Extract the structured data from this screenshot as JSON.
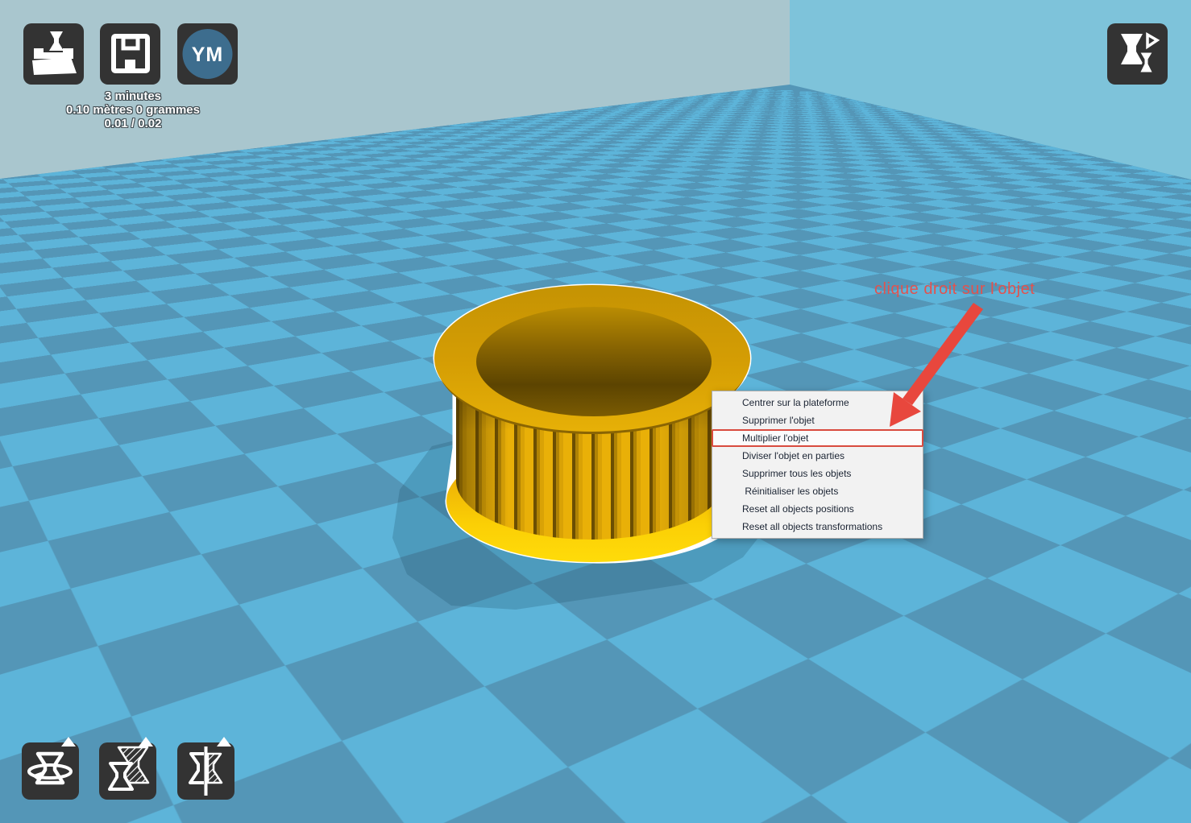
{
  "toolbar": {
    "ym_label": "YM"
  },
  "stats": {
    "line1": "3 minutes",
    "line2": "0.10 mètres 0 grammes",
    "line3": "0.01 / 0.02"
  },
  "annotation": {
    "label": "clique droit sur l'objet"
  },
  "context_menu": {
    "items": [
      "Centrer sur la plateforme",
      "Supprimer l'objet",
      "Multiplier l'objet",
      "Diviser l'objet en parties",
      "Supprimer tous les objets",
      " Réinitialiser les objets",
      "Reset all objects positions",
      "Reset all objects transformations"
    ],
    "highlighted_index": 2,
    "highlighted_label": "Multiplier l'objet"
  },
  "icons": {
    "load": "load-model-icon",
    "save": "save-toolpath-icon",
    "ym": "youmagine-icon",
    "view_mode": "view-mode-icon",
    "rotate": "rotate-icon",
    "scale": "scale-icon",
    "mirror": "mirror-icon"
  },
  "colors": {
    "annotation_red": "#e2524e",
    "highlight_red": "#d94b3f",
    "arrow_red": "#e8473d",
    "floor_light": "#5db4d9",
    "floor_dark": "#5496b7",
    "wall_left": "#a9c6ce",
    "wall_right": "#7ec3da",
    "button_bg": "#333333",
    "ym_circle": "#3d6d8e",
    "model_gold": "#d9a206",
    "model_bright_yellow": "#ffd800",
    "menu_bg": "#f2f2f2",
    "menu_text": "#1b2433"
  }
}
